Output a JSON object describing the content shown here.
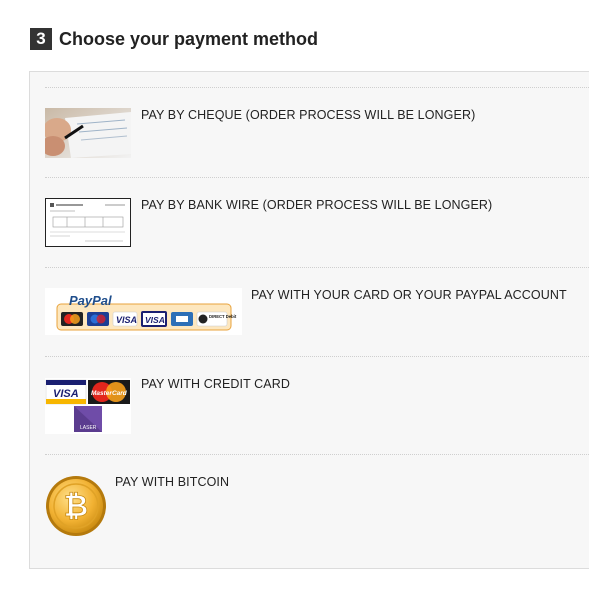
{
  "heading": {
    "step_number": "3",
    "title": "Choose your payment method"
  },
  "payment_options": [
    {
      "label": "PAY BY CHEQUE (ORDER PROCESS WILL BE LONGER)",
      "icon": "cheque-photo-icon"
    },
    {
      "label": "PAY BY BANK WIRE (ORDER PROCESS WILL BE LONGER)",
      "icon": "bank-wire-form-icon"
    },
    {
      "label": "PAY WITH YOUR CARD OR YOUR PAYPAL ACCOUNT",
      "icon": "paypal-cards-logo",
      "logo_text": "PayPal",
      "card_marks": [
        "VISA",
        "VISA",
        "DIRECT Debit"
      ]
    },
    {
      "label": "PAY WITH CREDIT CARD",
      "icon": "credit-card-logos",
      "card_marks": [
        "VISA",
        "MasterCard",
        "LASER"
      ]
    },
    {
      "label": "PAY WITH BITCOIN",
      "icon": "bitcoin-coin-icon",
      "symbol": "₿"
    }
  ],
  "colors": {
    "panel_background": "#f7f7f7",
    "step_badge": "#333333",
    "paypal_blue": "#1f4e8c",
    "paypal_orange": "#e8a33d",
    "bitcoin_gold": "#e8a317"
  }
}
